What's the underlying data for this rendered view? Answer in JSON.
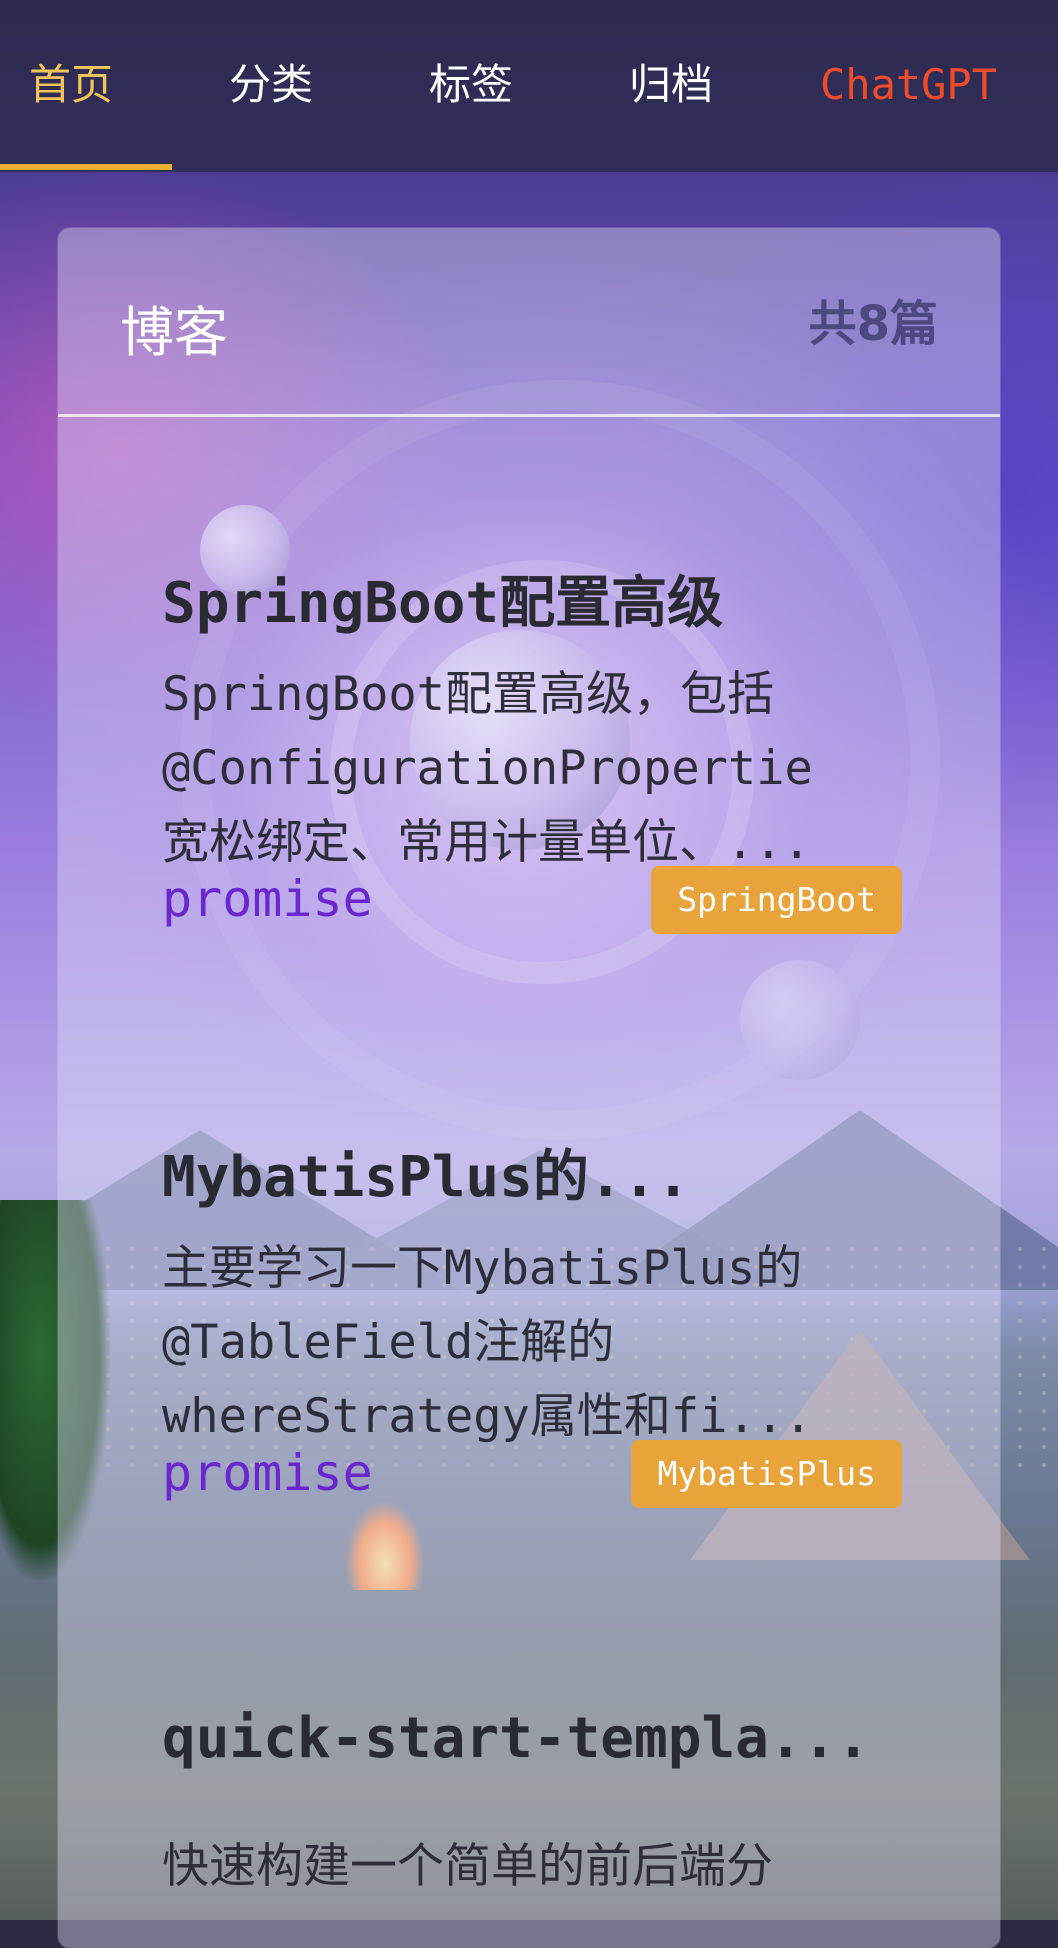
{
  "nav": {
    "items": [
      {
        "label": "首页",
        "active": true
      },
      {
        "label": "分类",
        "active": false
      },
      {
        "label": "标签",
        "active": false
      },
      {
        "label": "归档",
        "active": false
      },
      {
        "label": "ChatGPT",
        "active": false
      }
    ]
  },
  "card": {
    "title": "博客",
    "count_label": "共8篇"
  },
  "posts": [
    {
      "title": "SpringBoot配置高级",
      "description_lines": [
        "SpringBoot配置高级，包括",
        "@ConfigurationPropertie",
        "宽松绑定、常用计量单位、..."
      ],
      "author": "promise",
      "tag": "SpringBoot"
    },
    {
      "title": "MybatisPlus的...",
      "description_lines": [
        "主要学习一下MybatisPlus的",
        "@TableField注解的",
        "whereStrategy属性和fi..."
      ],
      "author": "promise",
      "tag": "MybatisPlus"
    },
    {
      "title": "quick-start-templa...",
      "description_lines": [
        "快速构建一个简单的前后端分"
      ]
    }
  ],
  "colors": {
    "nav_active": "#f1c35a",
    "nav_underline": "#f1b132",
    "chatgpt_link": "#ee4b2b",
    "author": "#6a26cf",
    "tag_bg": "#e8a43a"
  }
}
